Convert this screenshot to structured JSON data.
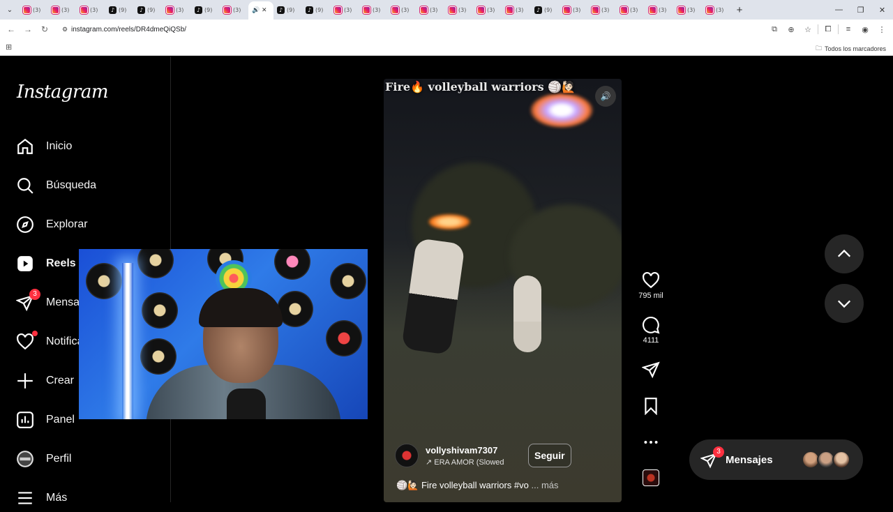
{
  "browser": {
    "tabs": [
      {
        "icon": "instagram",
        "label": "(3)"
      },
      {
        "icon": "instagram",
        "label": "(3)"
      },
      {
        "icon": "instagram",
        "label": "(3)"
      },
      {
        "icon": "instagram",
        "label": "(9)"
      },
      {
        "icon": "tiktok",
        "label": "(9)"
      },
      {
        "icon": "instagram",
        "label": "(3)"
      },
      {
        "icon": "tiktok",
        "label": "(9)"
      },
      {
        "icon": "instagram",
        "label": "(3)"
      }
    ],
    "tabs_after": [
      {
        "icon": "tiktok",
        "label": "(9)"
      },
      {
        "icon": "tiktok",
        "label": "(9)"
      },
      {
        "icon": "instagram",
        "label": "(3)"
      },
      {
        "icon": "instagram",
        "label": "(3)"
      },
      {
        "icon": "instagram",
        "label": "(3)"
      },
      {
        "icon": "instagram",
        "label": "(3)"
      },
      {
        "icon": "instagram",
        "label": "(3)"
      },
      {
        "icon": "instagram",
        "label": "(3)"
      },
      {
        "icon": "instagram",
        "label": "(3)"
      },
      {
        "icon": "tiktok",
        "label": "(9)"
      },
      {
        "icon": "instagram",
        "label": "(3)"
      },
      {
        "icon": "instagram",
        "label": "(3)"
      },
      {
        "icon": "instagram",
        "label": "(3)"
      },
      {
        "icon": "instagram",
        "label": "(3)"
      },
      {
        "icon": "instagram",
        "label": "(3)"
      },
      {
        "icon": "instagram",
        "label": "(3)"
      },
      {
        "icon": "instagram",
        "label": "(3)"
      },
      {
        "icon": "instagram",
        "label": "(3)"
      }
    ],
    "active_tab_icon": "speaker-icon",
    "url": "instagram.com/reels/DR4dmeQiQSb/",
    "bookmarks_label": "Todos los marcadores"
  },
  "instagram": {
    "logo": "Instagram",
    "nav": [
      {
        "key": "home",
        "label": "Inicio",
        "icon": "home-icon"
      },
      {
        "key": "search",
        "label": "Búsqueda",
        "icon": "search-icon"
      },
      {
        "key": "explore",
        "label": "Explorar",
        "icon": "compass-icon"
      },
      {
        "key": "reels",
        "label": "Reels",
        "icon": "reels-icon"
      },
      {
        "key": "messages",
        "label": "Mensaj",
        "icon": "messenger-icon",
        "badge": "3"
      },
      {
        "key": "notifications",
        "label": "Notifica",
        "icon": "heart-icon"
      },
      {
        "key": "create",
        "label": "Crear",
        "icon": "plus-icon"
      },
      {
        "key": "dashboard",
        "label": "Panel",
        "icon": "chart-icon"
      },
      {
        "key": "profile",
        "label": "Perfil",
        "icon": "avatar"
      },
      {
        "key": "more",
        "label": "Más",
        "icon": "menu-icon"
      }
    ],
    "reel": {
      "title_overlay": "Fire🔥 volleyball warriors 🏐🙋🏻",
      "author": "vollyshivam7307",
      "song": "↗ ERA AMOR (Slowed",
      "follow_label": "Seguir",
      "description": "🏐🙋🏻 Fire volleyball warriors #vo",
      "more_label": "... más"
    },
    "actions": {
      "likes": "795 mil",
      "comments": "4111"
    },
    "messages_pill": {
      "label": "Mensajes",
      "badge": "3"
    },
    "colors": {
      "badge": "#ff3040",
      "background": "#000000",
      "surface": "#262626"
    }
  }
}
